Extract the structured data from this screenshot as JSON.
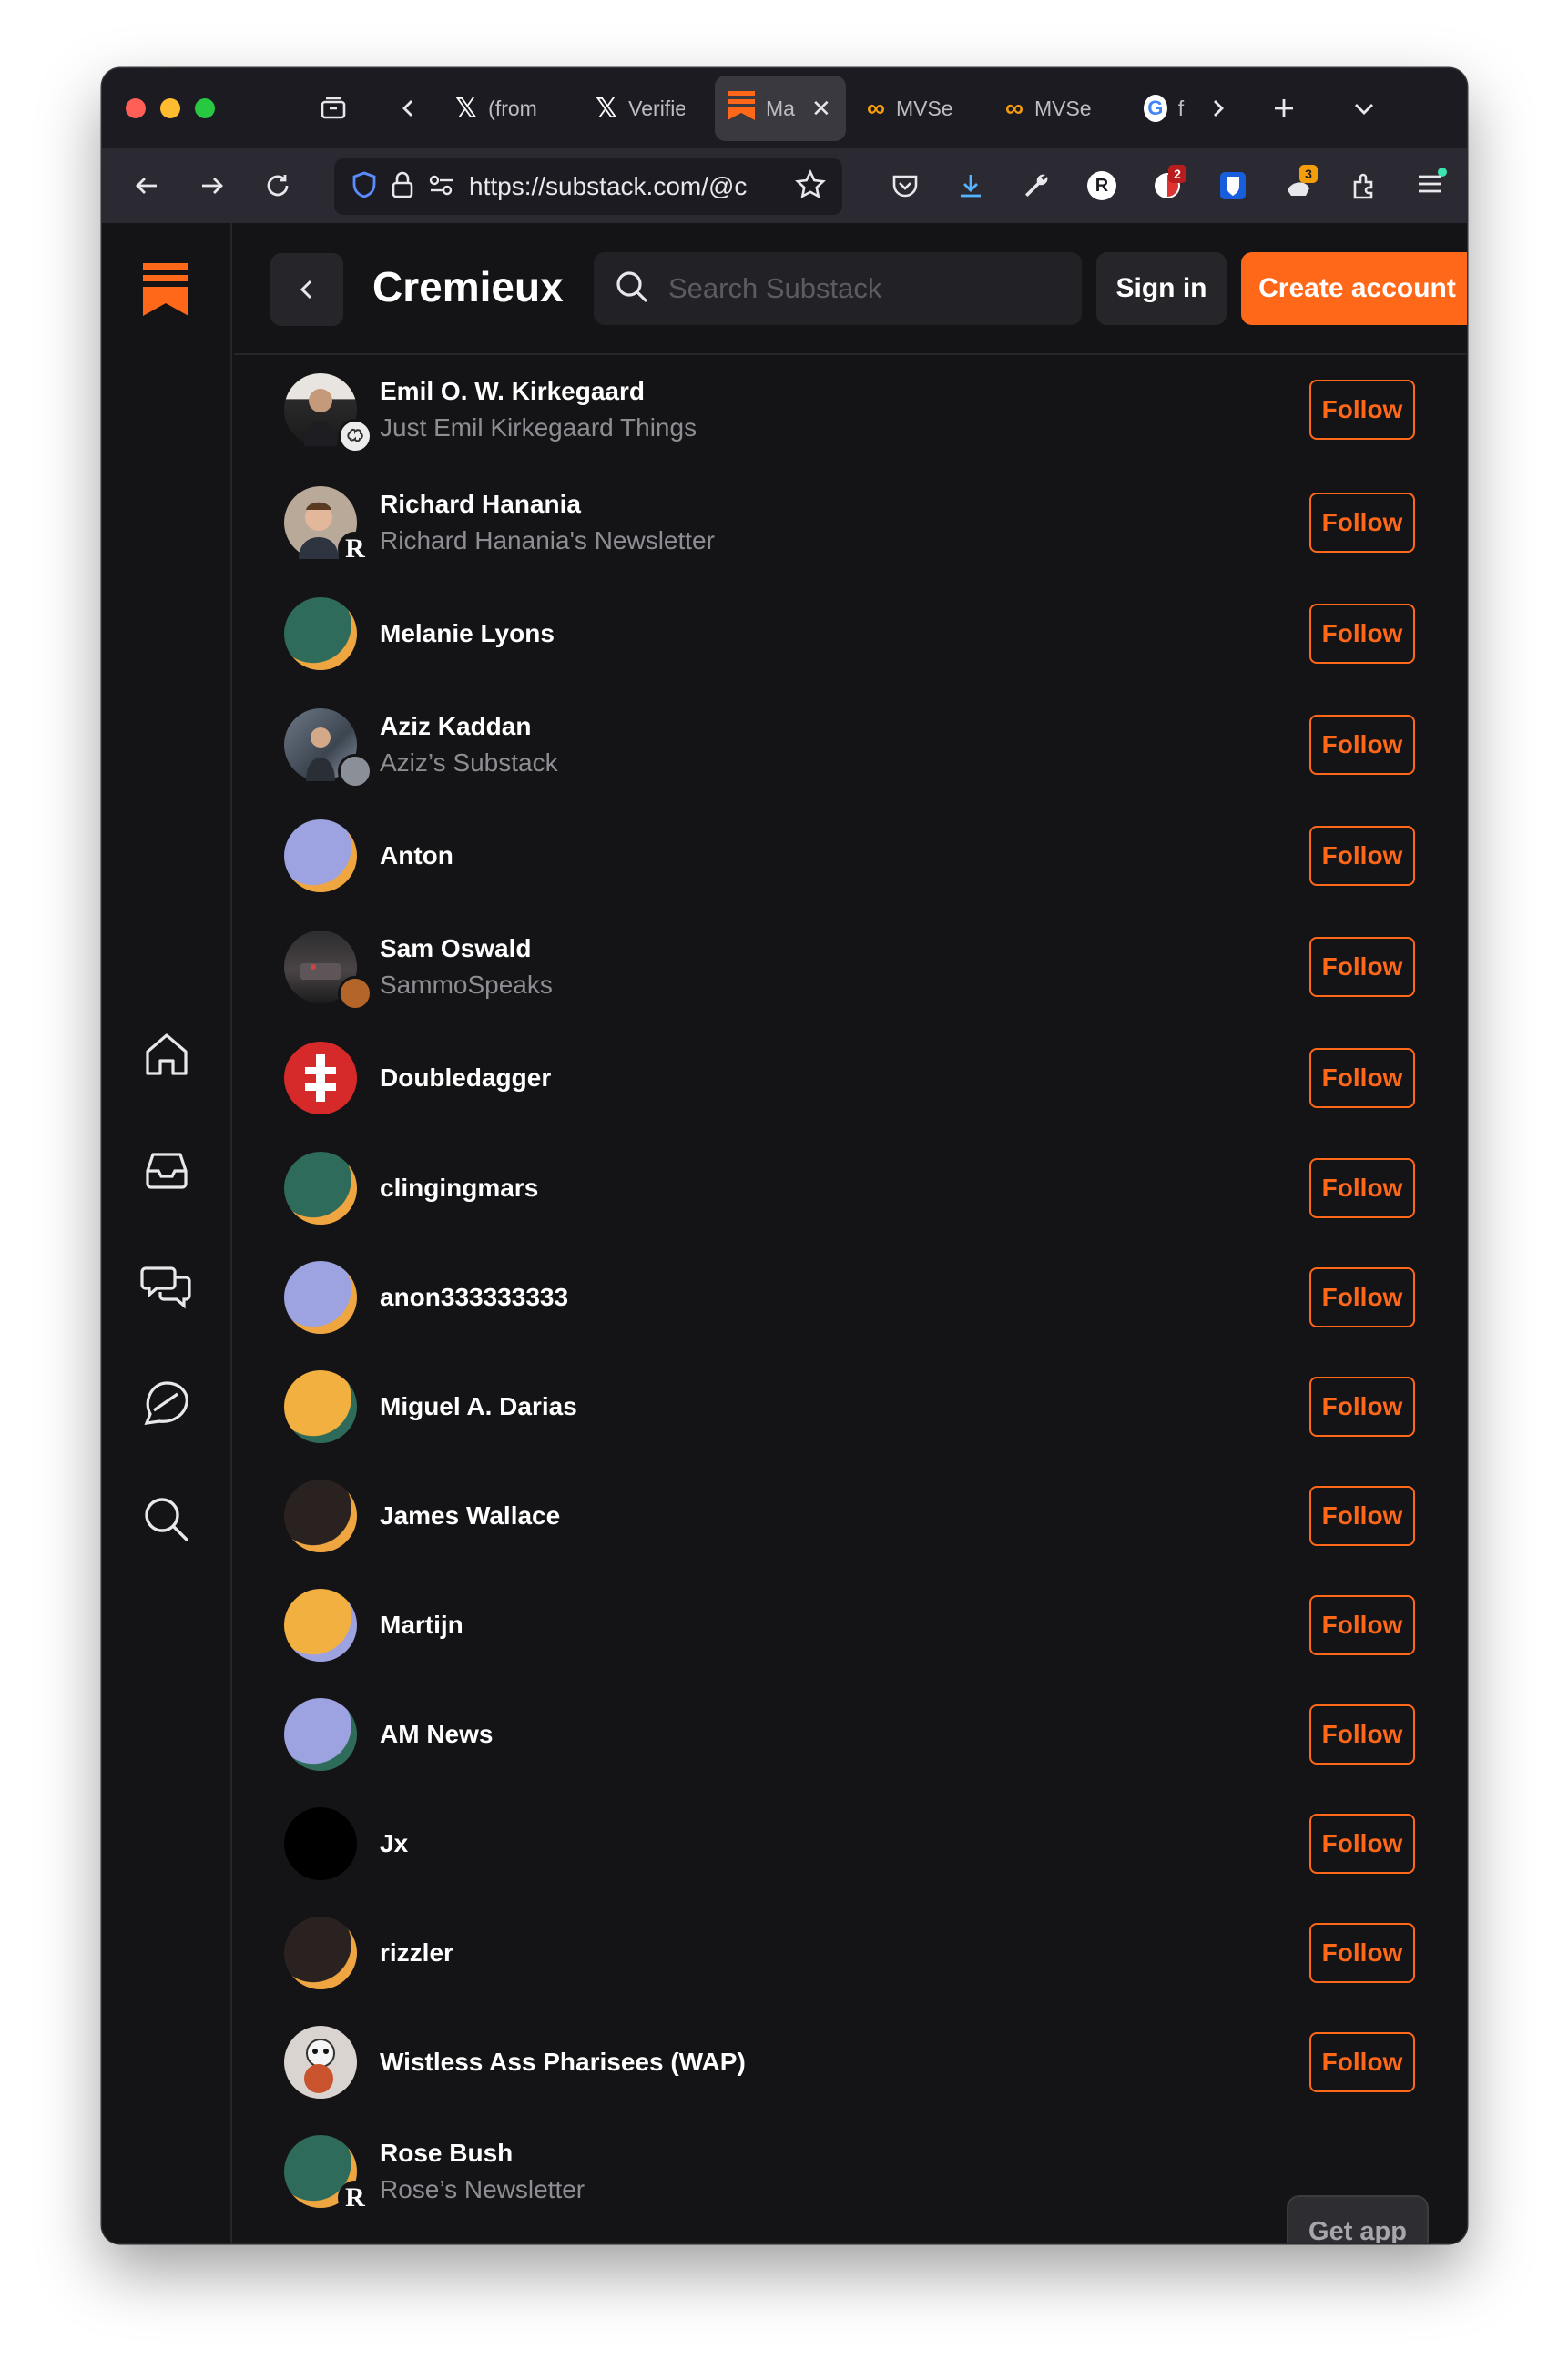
{
  "browser": {
    "tabs": [
      {
        "label": "(from",
        "icon": "x-logo-icon"
      },
      {
        "label": "Verifie",
        "icon": "x-logo-icon"
      },
      {
        "label": "Ma",
        "icon": "substack-icon",
        "active": true
      },
      {
        "label": "MVSe",
        "icon": "mvse-icon"
      },
      {
        "label": "MVSe",
        "icon": "mvse-icon"
      },
      {
        "label": "f",
        "icon": "google-icon"
      }
    ],
    "url": "https://substack.com/@c",
    "badges": {
      "extension_count_red": "2",
      "extension_count_orange": "3",
      "profile_letter": "R"
    }
  },
  "header": {
    "title": "Cremieux",
    "search_placeholder": "Search Substack",
    "signin_label": "Sign in",
    "create_label": "Create account"
  },
  "list": {
    "items": [
      {
        "name": "Emil O. W. Kirkegaard",
        "subtitle": "Just Emil Kirkegaard Things",
        "follow": "Follow"
      },
      {
        "name": "Richard Hanania",
        "subtitle": "Richard Hanania's Newsletter",
        "follow": "Follow"
      },
      {
        "name": "Melanie Lyons",
        "subtitle": "",
        "follow": "Follow"
      },
      {
        "name": "Aziz Kaddan",
        "subtitle": "Aziz’s Substack",
        "follow": "Follow"
      },
      {
        "name": "Anton",
        "subtitle": "",
        "follow": "Follow"
      },
      {
        "name": "Sam Oswald",
        "subtitle": "SammoSpeaks",
        "follow": "Follow"
      },
      {
        "name": "Doubledagger",
        "subtitle": "",
        "follow": "Follow"
      },
      {
        "name": "clingingmars",
        "subtitle": "",
        "follow": "Follow"
      },
      {
        "name": "anon333333333",
        "subtitle": "",
        "follow": "Follow"
      },
      {
        "name": "Miguel A. Darias",
        "subtitle": "",
        "follow": "Follow"
      },
      {
        "name": "James Wallace",
        "subtitle": "",
        "follow": "Follow"
      },
      {
        "name": "Martijn",
        "subtitle": "",
        "follow": "Follow"
      },
      {
        "name": "AM News",
        "subtitle": "",
        "follow": "Follow"
      },
      {
        "name": "Jx",
        "subtitle": "",
        "follow": "Follow"
      },
      {
        "name": "rizzler",
        "subtitle": "",
        "follow": "Follow"
      },
      {
        "name": "Wistless Ass Pharisees (WAP)",
        "subtitle": "",
        "follow": "Follow"
      },
      {
        "name": "Rose Bush",
        "subtitle": "Rose’s Newsletter",
        "follow": ""
      }
    ]
  },
  "get_app_label": "Get app",
  "colors": {
    "accent": "#ff6719",
    "background": "#141416"
  }
}
